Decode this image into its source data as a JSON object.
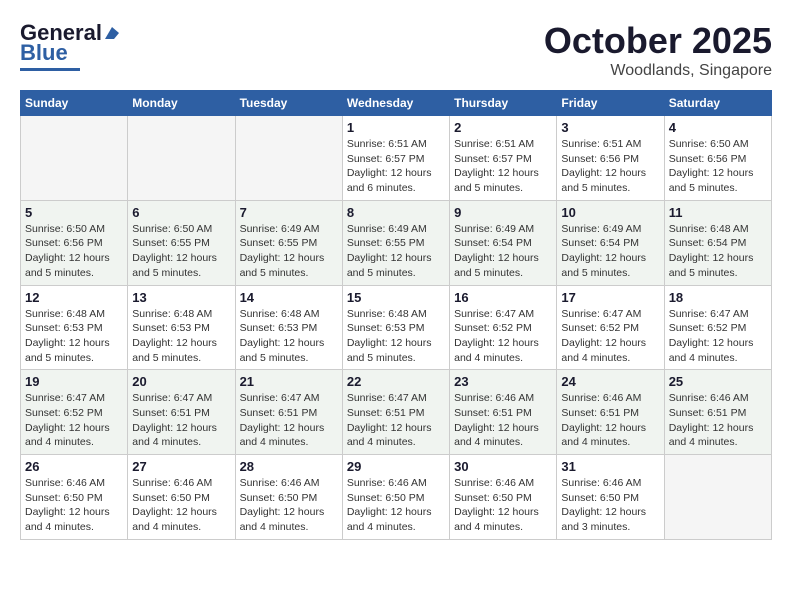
{
  "header": {
    "logo_general": "General",
    "logo_blue": "Blue",
    "month": "October 2025",
    "location": "Woodlands, Singapore"
  },
  "days_of_week": [
    "Sunday",
    "Monday",
    "Tuesday",
    "Wednesday",
    "Thursday",
    "Friday",
    "Saturday"
  ],
  "weeks": [
    [
      {
        "day": "",
        "info": ""
      },
      {
        "day": "",
        "info": ""
      },
      {
        "day": "",
        "info": ""
      },
      {
        "day": "1",
        "info": "Sunrise: 6:51 AM\nSunset: 6:57 PM\nDaylight: 12 hours\nand 6 minutes."
      },
      {
        "day": "2",
        "info": "Sunrise: 6:51 AM\nSunset: 6:57 PM\nDaylight: 12 hours\nand 5 minutes."
      },
      {
        "day": "3",
        "info": "Sunrise: 6:51 AM\nSunset: 6:56 PM\nDaylight: 12 hours\nand 5 minutes."
      },
      {
        "day": "4",
        "info": "Sunrise: 6:50 AM\nSunset: 6:56 PM\nDaylight: 12 hours\nand 5 minutes."
      }
    ],
    [
      {
        "day": "5",
        "info": "Sunrise: 6:50 AM\nSunset: 6:56 PM\nDaylight: 12 hours\nand 5 minutes."
      },
      {
        "day": "6",
        "info": "Sunrise: 6:50 AM\nSunset: 6:55 PM\nDaylight: 12 hours\nand 5 minutes."
      },
      {
        "day": "7",
        "info": "Sunrise: 6:49 AM\nSunset: 6:55 PM\nDaylight: 12 hours\nand 5 minutes."
      },
      {
        "day": "8",
        "info": "Sunrise: 6:49 AM\nSunset: 6:55 PM\nDaylight: 12 hours\nand 5 minutes."
      },
      {
        "day": "9",
        "info": "Sunrise: 6:49 AM\nSunset: 6:54 PM\nDaylight: 12 hours\nand 5 minutes."
      },
      {
        "day": "10",
        "info": "Sunrise: 6:49 AM\nSunset: 6:54 PM\nDaylight: 12 hours\nand 5 minutes."
      },
      {
        "day": "11",
        "info": "Sunrise: 6:48 AM\nSunset: 6:54 PM\nDaylight: 12 hours\nand 5 minutes."
      }
    ],
    [
      {
        "day": "12",
        "info": "Sunrise: 6:48 AM\nSunset: 6:53 PM\nDaylight: 12 hours\nand 5 minutes."
      },
      {
        "day": "13",
        "info": "Sunrise: 6:48 AM\nSunset: 6:53 PM\nDaylight: 12 hours\nand 5 minutes."
      },
      {
        "day": "14",
        "info": "Sunrise: 6:48 AM\nSunset: 6:53 PM\nDaylight: 12 hours\nand 5 minutes."
      },
      {
        "day": "15",
        "info": "Sunrise: 6:48 AM\nSunset: 6:53 PM\nDaylight: 12 hours\nand 5 minutes."
      },
      {
        "day": "16",
        "info": "Sunrise: 6:47 AM\nSunset: 6:52 PM\nDaylight: 12 hours\nand 4 minutes."
      },
      {
        "day": "17",
        "info": "Sunrise: 6:47 AM\nSunset: 6:52 PM\nDaylight: 12 hours\nand 4 minutes."
      },
      {
        "day": "18",
        "info": "Sunrise: 6:47 AM\nSunset: 6:52 PM\nDaylight: 12 hours\nand 4 minutes."
      }
    ],
    [
      {
        "day": "19",
        "info": "Sunrise: 6:47 AM\nSunset: 6:52 PM\nDaylight: 12 hours\nand 4 minutes."
      },
      {
        "day": "20",
        "info": "Sunrise: 6:47 AM\nSunset: 6:51 PM\nDaylight: 12 hours\nand 4 minutes."
      },
      {
        "day": "21",
        "info": "Sunrise: 6:47 AM\nSunset: 6:51 PM\nDaylight: 12 hours\nand 4 minutes."
      },
      {
        "day": "22",
        "info": "Sunrise: 6:47 AM\nSunset: 6:51 PM\nDaylight: 12 hours\nand 4 minutes."
      },
      {
        "day": "23",
        "info": "Sunrise: 6:46 AM\nSunset: 6:51 PM\nDaylight: 12 hours\nand 4 minutes."
      },
      {
        "day": "24",
        "info": "Sunrise: 6:46 AM\nSunset: 6:51 PM\nDaylight: 12 hours\nand 4 minutes."
      },
      {
        "day": "25",
        "info": "Sunrise: 6:46 AM\nSunset: 6:51 PM\nDaylight: 12 hours\nand 4 minutes."
      }
    ],
    [
      {
        "day": "26",
        "info": "Sunrise: 6:46 AM\nSunset: 6:50 PM\nDaylight: 12 hours\nand 4 minutes."
      },
      {
        "day": "27",
        "info": "Sunrise: 6:46 AM\nSunset: 6:50 PM\nDaylight: 12 hours\nand 4 minutes."
      },
      {
        "day": "28",
        "info": "Sunrise: 6:46 AM\nSunset: 6:50 PM\nDaylight: 12 hours\nand 4 minutes."
      },
      {
        "day": "29",
        "info": "Sunrise: 6:46 AM\nSunset: 6:50 PM\nDaylight: 12 hours\nand 4 minutes."
      },
      {
        "day": "30",
        "info": "Sunrise: 6:46 AM\nSunset: 6:50 PM\nDaylight: 12 hours\nand 4 minutes."
      },
      {
        "day": "31",
        "info": "Sunrise: 6:46 AM\nSunset: 6:50 PM\nDaylight: 12 hours\nand 3 minutes."
      },
      {
        "day": "",
        "info": ""
      }
    ]
  ]
}
